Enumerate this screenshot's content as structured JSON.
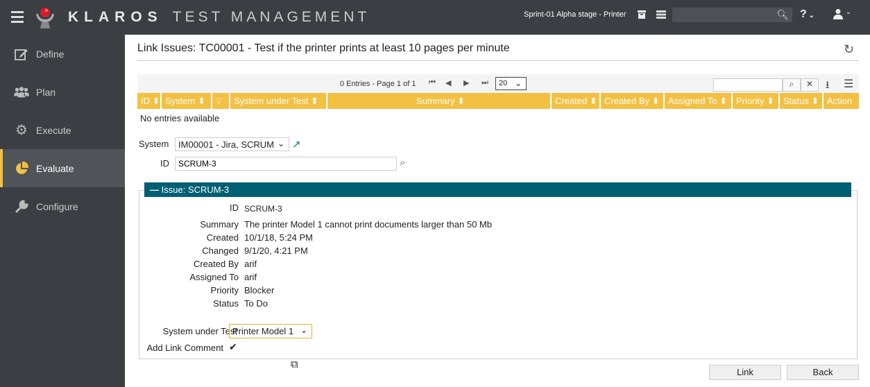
{
  "header": {
    "brand_primary": "KLAROS",
    "brand_secondary": "TEST MANAGEMENT",
    "context": "Sprint-01 Alpha stage  -  Printer",
    "search_placeholder": ""
  },
  "sidebar": {
    "items": [
      {
        "label": "Define",
        "icon": "edit-icon",
        "active": false
      },
      {
        "label": "Plan",
        "icon": "users-icon",
        "active": false
      },
      {
        "label": "Execute",
        "icon": "gear-icon",
        "active": false
      },
      {
        "label": "Evaluate",
        "icon": "pie-chart-icon",
        "active": true
      },
      {
        "label": "Configure",
        "icon": "wrench-icon",
        "active": false
      }
    ]
  },
  "page": {
    "title": "Link Issues: TC00001 - Test if the printer prints at least 10 pages per minute"
  },
  "table": {
    "pager_text": "0 Entries - Page 1 of 1",
    "page_size": "20",
    "search_value": "",
    "columns": [
      "ID",
      "System",
      "",
      "System under Test",
      "Summary",
      "Created",
      "Created By",
      "Assigned To",
      "Priority",
      "Status",
      "Action"
    ],
    "empty_text": "No entries available"
  },
  "form": {
    "system_label": "System",
    "system_value": "IM00001 - Jira, SCRUM",
    "id_label": "ID",
    "id_value": "SCRUM-3"
  },
  "issue": {
    "header": "Issue: SCRUM-3",
    "fields": [
      {
        "label": "ID",
        "value": "SCRUM-3"
      },
      {
        "label": "Summary",
        "value": "The printer Model 1 cannot print documents larger than 50 Mb"
      },
      {
        "label": "Created",
        "value": "10/1/18, 5:24 PM"
      },
      {
        "label": "Changed",
        "value": "9/1/20, 4:21 PM"
      },
      {
        "label": "Created By",
        "value": "arif"
      },
      {
        "label": "Assigned To",
        "value": "arif"
      },
      {
        "label": "Priority",
        "value": "Blocker"
      },
      {
        "label": "Status",
        "value": "To Do"
      }
    ],
    "sut_label": "System under Test",
    "sut_value": "Printer Model 1",
    "comment_label": "Add Link Comment",
    "comment_checked": true
  },
  "buttons": {
    "link": "Link",
    "back": "Back"
  },
  "colors": {
    "accent": "#f3c041",
    "issue_header": "#005f73",
    "topbar": "#3b3e42"
  }
}
